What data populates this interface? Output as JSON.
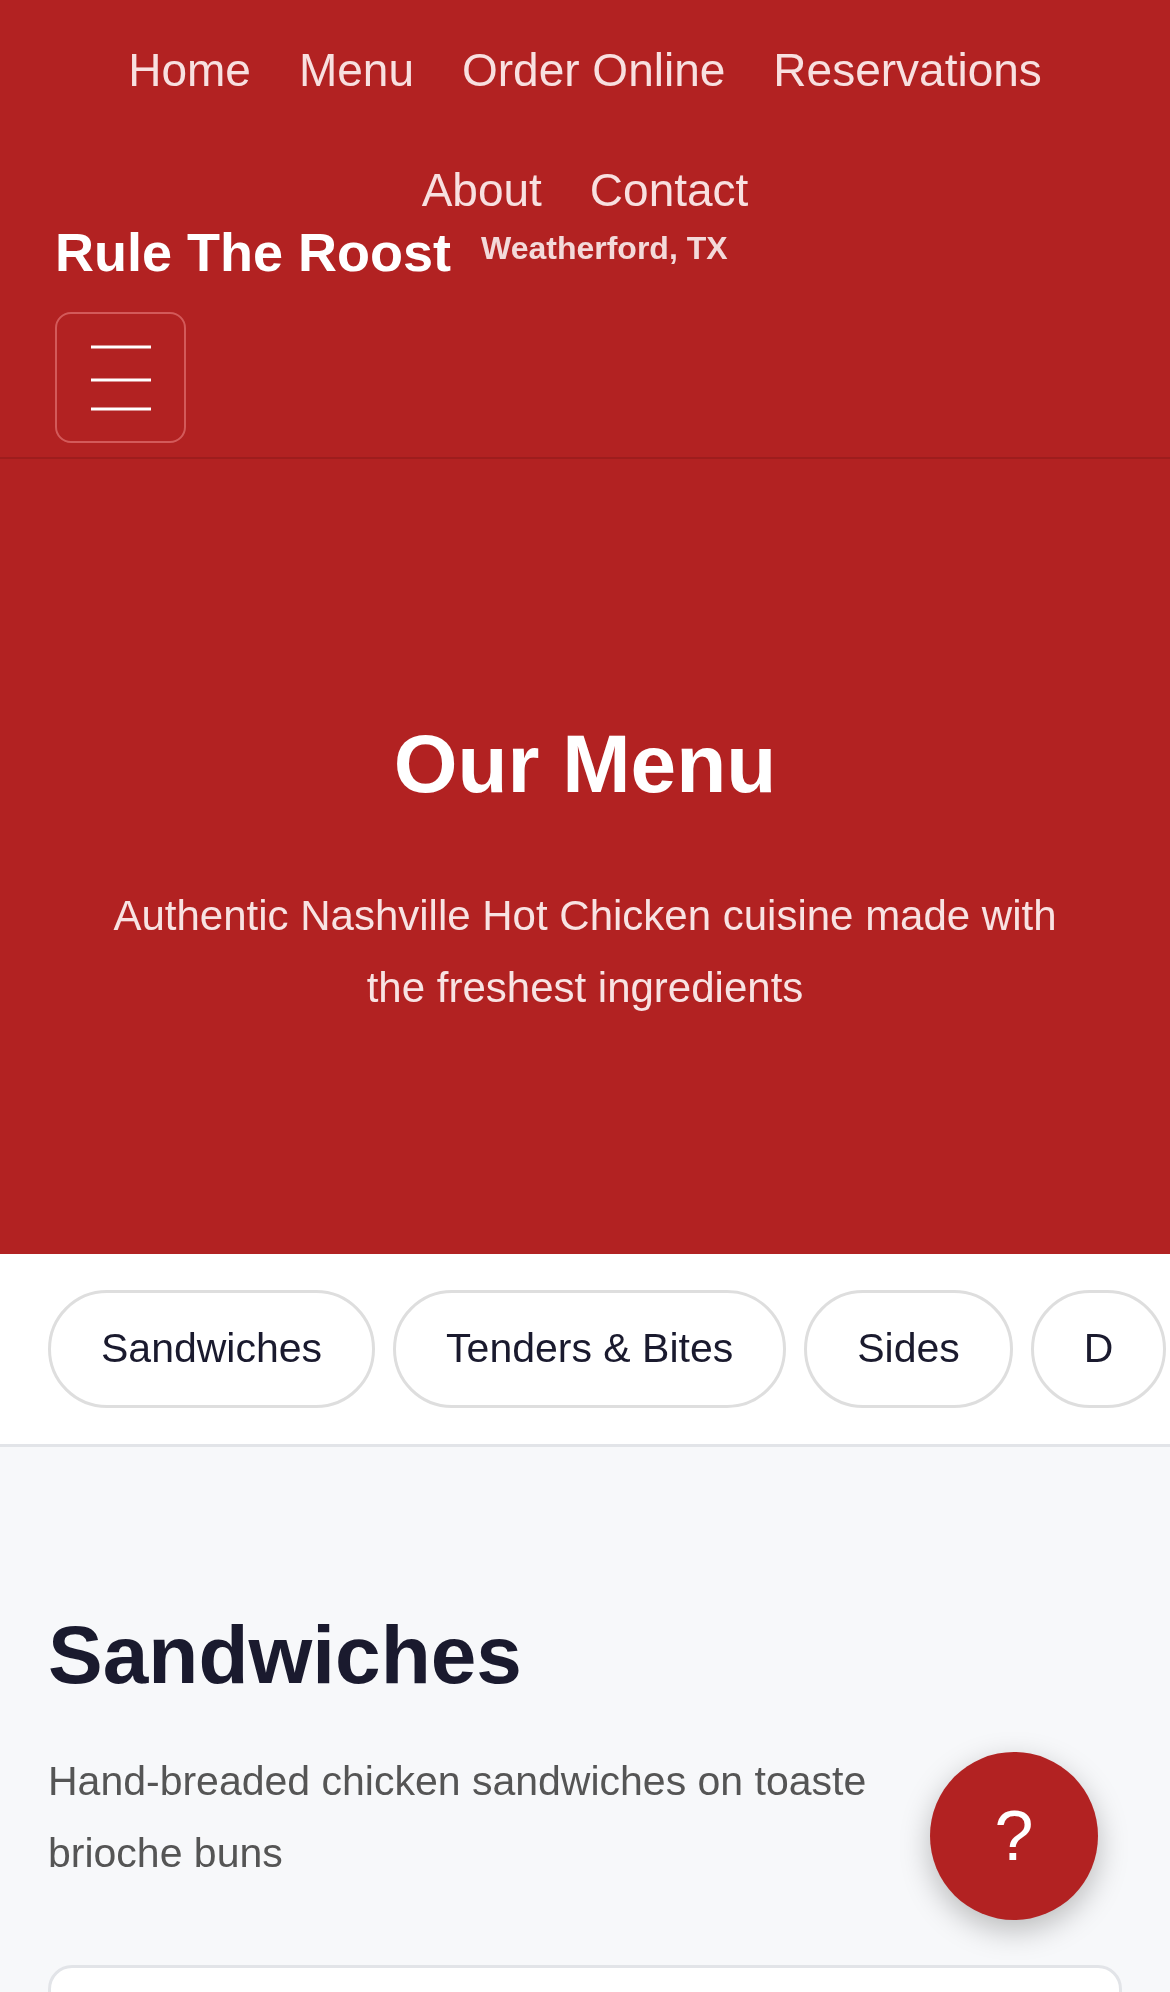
{
  "nav": {
    "links": [
      "Home",
      "Menu",
      "Order Online",
      "Reservations",
      "About",
      "Contact"
    ]
  },
  "brand": {
    "name": "Rule The Roost",
    "location": "Weatherford, TX"
  },
  "hero": {
    "title": "Our Menu",
    "subtitle": "Authentic Nashville Hot Chicken cuisine made with the freshest ingredients"
  },
  "category_tabs": [
    "Sandwiches",
    "Tenders & Bites",
    "Sides",
    "D"
  ],
  "section": {
    "title": "Sandwiches",
    "description": "Hand-breaded chicken sandwiches on toaste brioche buns"
  },
  "help_button": {
    "label": "?"
  }
}
